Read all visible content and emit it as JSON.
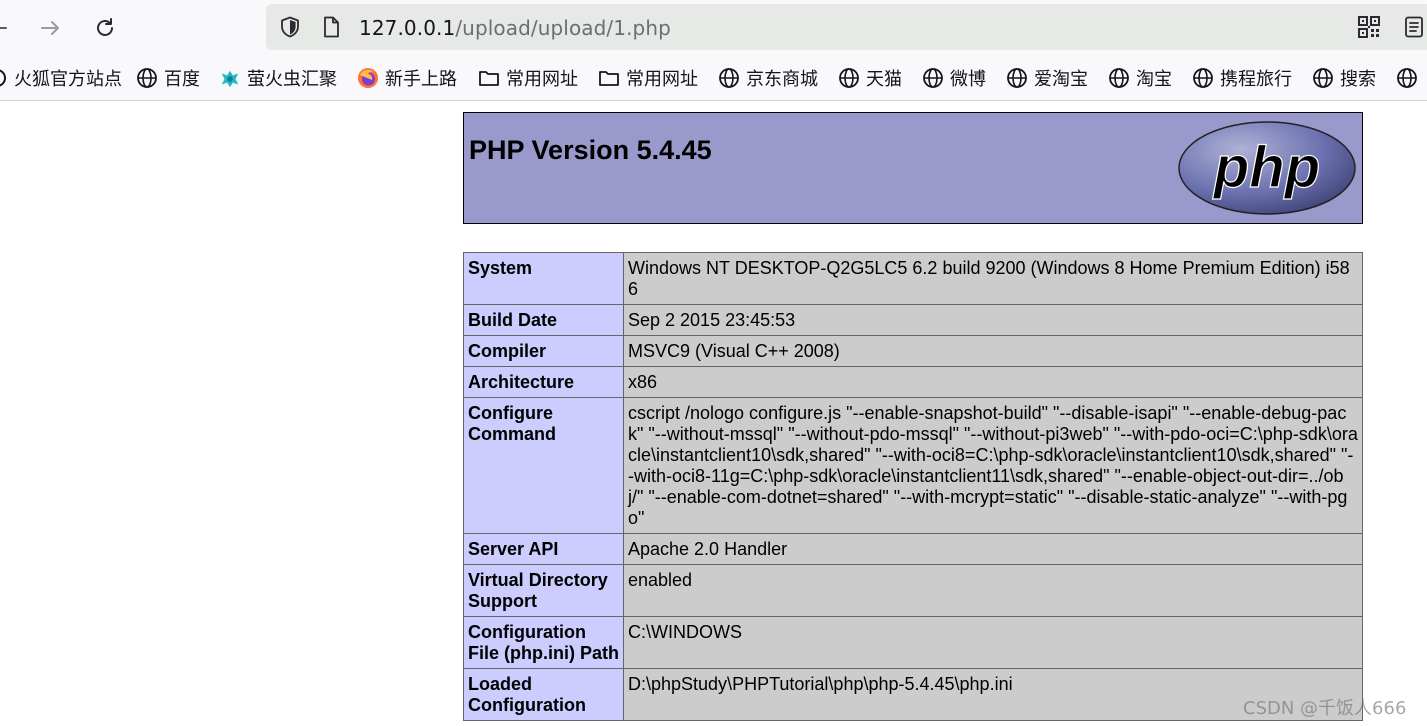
{
  "browser": {
    "url_host": "127.0.0.1",
    "url_path": "/upload/upload/1.php",
    "bookmarks": [
      {
        "label": "火狐官方站点",
        "icon": "firefox-partial-icon"
      },
      {
        "label": "百度",
        "icon": "globe-icon"
      },
      {
        "label": "萤火虫汇聚",
        "icon": "firefly-icon"
      },
      {
        "label": "新手上路",
        "icon": "firefox-icon"
      },
      {
        "label": "常用网址",
        "icon": "folder-icon"
      },
      {
        "label": "常用网址",
        "icon": "folder-icon"
      },
      {
        "label": "京东商城",
        "icon": "globe-icon"
      },
      {
        "label": "天猫",
        "icon": "globe-icon"
      },
      {
        "label": "微博",
        "icon": "globe-icon"
      },
      {
        "label": "爱淘宝",
        "icon": "globe-icon"
      },
      {
        "label": "淘宝",
        "icon": "globe-icon"
      },
      {
        "label": "携程旅行",
        "icon": "globe-icon"
      },
      {
        "label": "搜索",
        "icon": "globe-icon"
      }
    ]
  },
  "phpinfo": {
    "title": "PHP Version 5.4.45",
    "logo_text": "php",
    "rows": [
      {
        "key": "System",
        "value": "Windows NT DESKTOP-Q2G5LC5 6.2 build 9200 (Windows 8 Home Premium Edition) i586"
      },
      {
        "key": "Build Date",
        "value": "Sep 2 2015 23:45:53"
      },
      {
        "key": "Compiler",
        "value": "MSVC9 (Visual C++ 2008)"
      },
      {
        "key": "Architecture",
        "value": "x86"
      },
      {
        "key": "Configure Command",
        "value": "cscript /nologo configure.js \"--enable-snapshot-build\" \"--disable-isapi\" \"--enable-debug-pack\" \"--without-mssql\" \"--without-pdo-mssql\" \"--without-pi3web\" \"--with-pdo-oci=C:\\php-sdk\\oracle\\instantclient10\\sdk,shared\" \"--with-oci8=C:\\php-sdk\\oracle\\instantclient10\\sdk,shared\" \"--with-oci8-11g=C:\\php-sdk\\oracle\\instantclient11\\sdk,shared\" \"--enable-object-out-dir=../obj/\" \"--enable-com-dotnet=shared\" \"--with-mcrypt=static\" \"--disable-static-analyze\" \"--with-pgo\""
      },
      {
        "key": "Server API",
        "value": "Apache 2.0 Handler"
      },
      {
        "key": "Virtual Directory Support",
        "value": "enabled"
      },
      {
        "key": "Configuration File (php.ini) Path",
        "value": "C:\\WINDOWS"
      },
      {
        "key": "Loaded Configuration",
        "value": "D:\\phpStudy\\PHPTutorial\\php\\php-5.4.45\\php.ini"
      }
    ]
  },
  "watermark": "CSDN @千饭人666"
}
